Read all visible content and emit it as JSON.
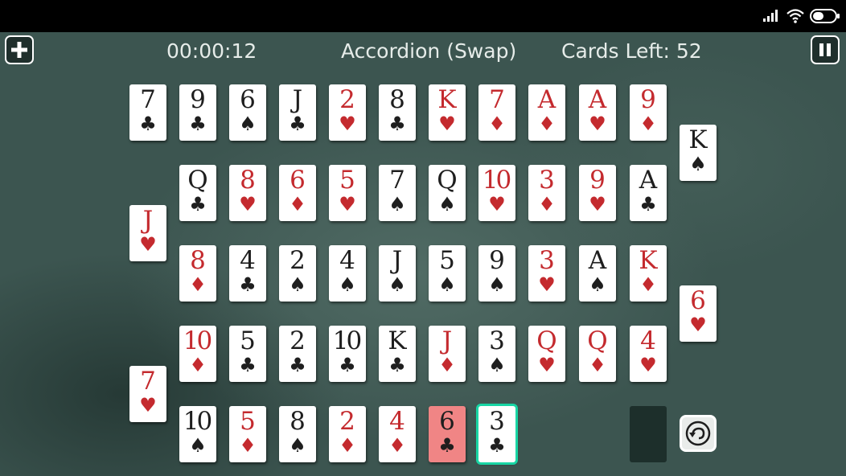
{
  "game": {
    "timer": "00:00:12",
    "title": "Accordion (Swap)",
    "cards_left": "Cards Left: 52"
  },
  "buttons": {
    "menu_icon": "plus-icon",
    "pause_icon": "pause-icon",
    "undo_icon": "undo-icon"
  },
  "status_icons": [
    "signal-icon",
    "wifi-icon",
    "battery-icon"
  ],
  "colors": {
    "table": "#3c5550",
    "red_suit": "#c42a2e",
    "black_suit": "#1e1e1e",
    "selected_card": "#f08585",
    "highlight_outline": "#18d6a4"
  },
  "rows": [
    {
      "cards": [
        {
          "rank": "7",
          "suit": "♣"
        },
        {
          "rank": "9",
          "suit": "♣"
        },
        {
          "rank": "6",
          "suit": "♠"
        },
        {
          "rank": "J",
          "suit": "♣"
        },
        {
          "rank": "2",
          "suit": "♥"
        },
        {
          "rank": "8",
          "suit": "♣"
        },
        {
          "rank": "K",
          "suit": "♥"
        },
        {
          "rank": "7",
          "suit": "♦"
        },
        {
          "rank": "A",
          "suit": "♦"
        },
        {
          "rank": "A",
          "suit": "♥"
        },
        {
          "rank": "9",
          "suit": "♦"
        },
        {
          "rank": "K",
          "suit": "♠"
        }
      ]
    },
    {
      "cards": [
        {
          "rank": "Q",
          "suit": "♣"
        },
        {
          "rank": "8",
          "suit": "♥"
        },
        {
          "rank": "6",
          "suit": "♦"
        },
        {
          "rank": "5",
          "suit": "♥"
        },
        {
          "rank": "7",
          "suit": "♠"
        },
        {
          "rank": "Q",
          "suit": "♠"
        },
        {
          "rank": "10",
          "suit": "♥"
        },
        {
          "rank": "3",
          "suit": "♦"
        },
        {
          "rank": "9",
          "suit": "♥"
        },
        {
          "rank": "A",
          "suit": "♣"
        },
        {
          "rank": "J",
          "suit": "♥"
        }
      ]
    },
    {
      "cards": [
        {
          "rank": "8",
          "suit": "♦"
        },
        {
          "rank": "4",
          "suit": "♣"
        },
        {
          "rank": "2",
          "suit": "♠"
        },
        {
          "rank": "4",
          "suit": "♠"
        },
        {
          "rank": "J",
          "suit": "♠"
        },
        {
          "rank": "5",
          "suit": "♠"
        },
        {
          "rank": "9",
          "suit": "♠"
        },
        {
          "rank": "3",
          "suit": "♥"
        },
        {
          "rank": "A",
          "suit": "♠"
        },
        {
          "rank": "K",
          "suit": "♦"
        },
        {
          "rank": "6",
          "suit": "♥"
        }
      ]
    },
    {
      "cards": [
        {
          "rank": "10",
          "suit": "♦"
        },
        {
          "rank": "5",
          "suit": "♣"
        },
        {
          "rank": "2",
          "suit": "♣"
        },
        {
          "rank": "10",
          "suit": "♣"
        },
        {
          "rank": "K",
          "suit": "♣"
        },
        {
          "rank": "J",
          "suit": "♦"
        },
        {
          "rank": "3",
          "suit": "♠"
        },
        {
          "rank": "Q",
          "suit": "♥"
        },
        {
          "rank": "Q",
          "suit": "♦"
        },
        {
          "rank": "4",
          "suit": "♥"
        },
        {
          "rank": "7",
          "suit": "♥"
        }
      ]
    },
    {
      "cards": [
        {
          "rank": "10",
          "suit": "♠"
        },
        {
          "rank": "5",
          "suit": "♦"
        },
        {
          "rank": "8",
          "suit": "♠"
        },
        {
          "rank": "2",
          "suit": "♦"
        },
        {
          "rank": "4",
          "suit": "♦"
        },
        {
          "rank": "6",
          "suit": "♣",
          "state": "selected"
        },
        {
          "rank": "3",
          "suit": "♣",
          "state": "highlight"
        }
      ]
    }
  ],
  "stock": {
    "state": "face-down"
  }
}
